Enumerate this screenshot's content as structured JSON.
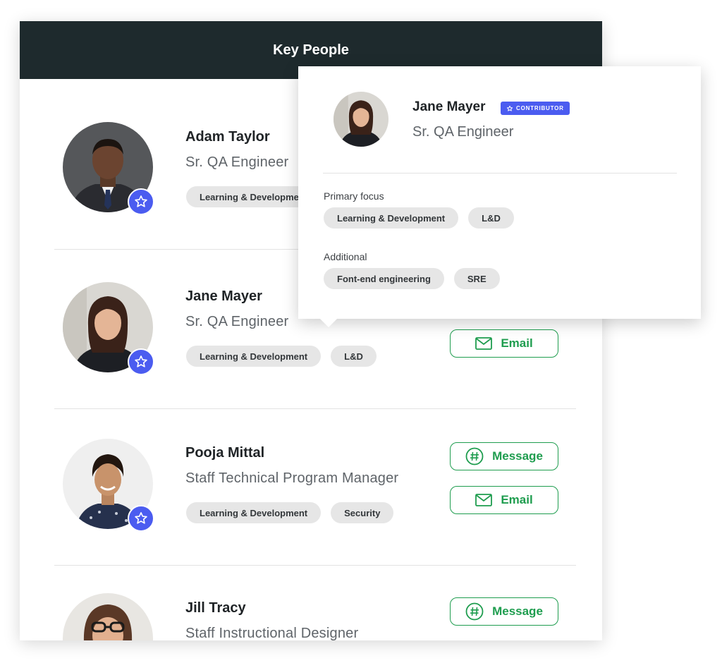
{
  "header": {
    "title": "Key People"
  },
  "people": [
    {
      "name": "Adam Taylor",
      "title": "Sr. QA Engineer",
      "tags": [
        "Learning & Developme"
      ]
    },
    {
      "name": "Jane Mayer",
      "title": "Sr. QA Engineer",
      "tags": [
        "Learning & Development",
        "L&D"
      ],
      "email_label": "Email"
    },
    {
      "name": "Pooja Mittal",
      "title": "Staff Technical Program Manager",
      "tags": [
        "Learning & Development",
        "Security"
      ],
      "message_label": "Message",
      "email_label": "Email"
    },
    {
      "name": "Jill Tracy",
      "title": "Staff Instructional Designer",
      "message_label": "Message"
    }
  ],
  "popover": {
    "name": "Jane Mayer",
    "badge": "CONTRIBUTOR",
    "title": "Sr. QA Engineer",
    "primary_label": "Primary focus",
    "primary_tags": [
      "Learning & Development",
      "L&D"
    ],
    "additional_label": "Additional",
    "additional_tags": [
      "Font-end engineering",
      "SRE"
    ]
  },
  "icons": {
    "favorite": "star-icon",
    "email": "envelope-icon",
    "message": "hashtag-chat-icon"
  },
  "colors": {
    "header_bg": "#1e2a2d",
    "accent_blue": "#4b5cf0",
    "action_green": "#1f9d4f",
    "tag_bg": "#e6e6e6"
  }
}
